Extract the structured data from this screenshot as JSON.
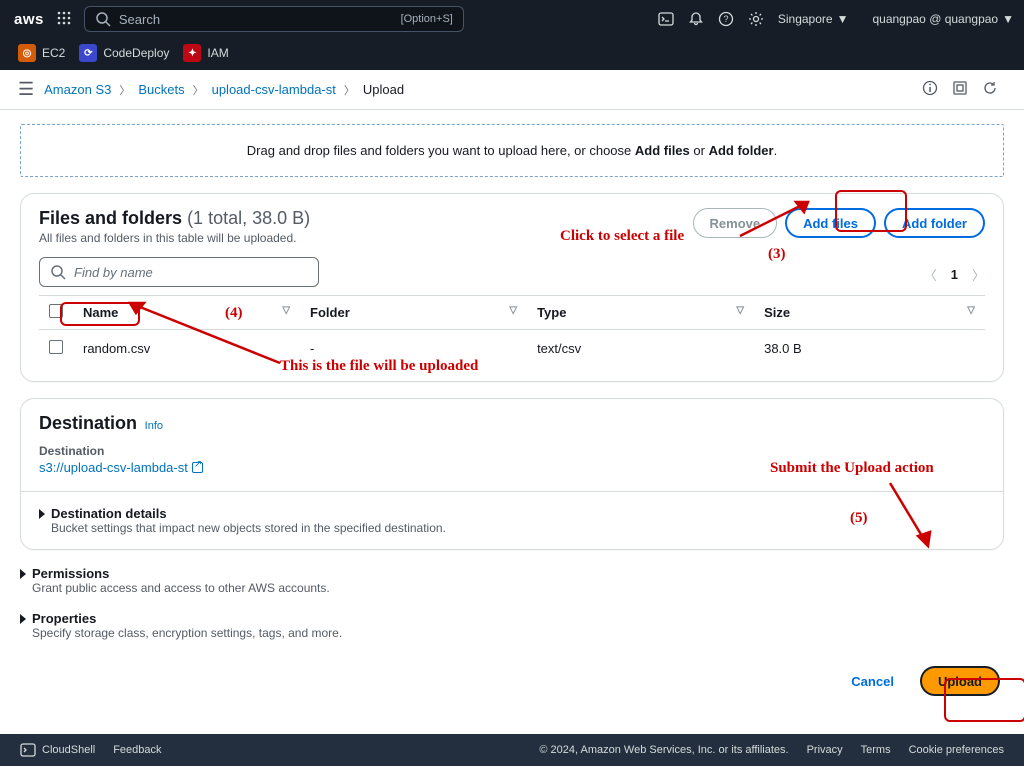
{
  "header": {
    "search_placeholder": "Search",
    "search_shortcut": "[Option+S]",
    "region": "Singapore",
    "user": "quangpao @ quangpao",
    "services": [
      {
        "code": "EC",
        "label": "EC2"
      },
      {
        "code": "CD",
        "label": "CodeDeploy"
      },
      {
        "code": "IA",
        "label": "IAM"
      }
    ]
  },
  "breadcrumb": {
    "items": [
      {
        "label": "Amazon S3",
        "link": true
      },
      {
        "label": "Buckets",
        "link": true
      },
      {
        "label": "upload-csv-lambda-st",
        "link": true
      },
      {
        "label": "Upload",
        "link": false
      }
    ]
  },
  "dropzone": {
    "text_a": "Drag and drop files and folders you want to upload here, or choose ",
    "addfiles": "Add files",
    "or": " or ",
    "addfolder": "Add folder",
    "suffix": "."
  },
  "files_panel": {
    "title": "Files and folders",
    "count": "(1 total, 38.0 B)",
    "subtitle": "All files and folders in this table will be uploaded.",
    "btn_remove": "Remove",
    "btn_addfiles": "Add files",
    "btn_addfolder": "Add folder",
    "search_placeholder": "Find by name",
    "page": "1",
    "cols": {
      "name": "Name",
      "folder": "Folder",
      "type": "Type",
      "size": "Size"
    },
    "rows": [
      {
        "name": "random.csv",
        "folder": "-",
        "type": "text/csv",
        "size": "38.0 B"
      }
    ]
  },
  "destination": {
    "title": "Destination",
    "info": "Info",
    "label": "Destination",
    "uri": "s3://upload-csv-lambda-st",
    "details_title": "Destination details",
    "details_desc": "Bucket settings that impact new objects stored in the specified destination."
  },
  "permissions": {
    "title": "Permissions",
    "desc": "Grant public access and access to other AWS accounts."
  },
  "properties": {
    "title": "Properties",
    "desc": "Specify storage class, encryption settings, tags, and more."
  },
  "actions": {
    "cancel": "Cancel",
    "upload": "Upload"
  },
  "footer": {
    "cloudshell": "CloudShell",
    "feedback": "Feedback",
    "copyright": "© 2024, Amazon Web Services, Inc. or its affiliates.",
    "privacy": "Privacy",
    "terms": "Terms",
    "cookie": "Cookie preferences"
  },
  "annotations": {
    "a3_text": "Click to select a file",
    "a3_num": "(3)",
    "a4_num": "(4)",
    "a4_text": "This is the file will be uploaded",
    "a5_text": "Submit the Upload action",
    "a5_num": "(5)"
  }
}
